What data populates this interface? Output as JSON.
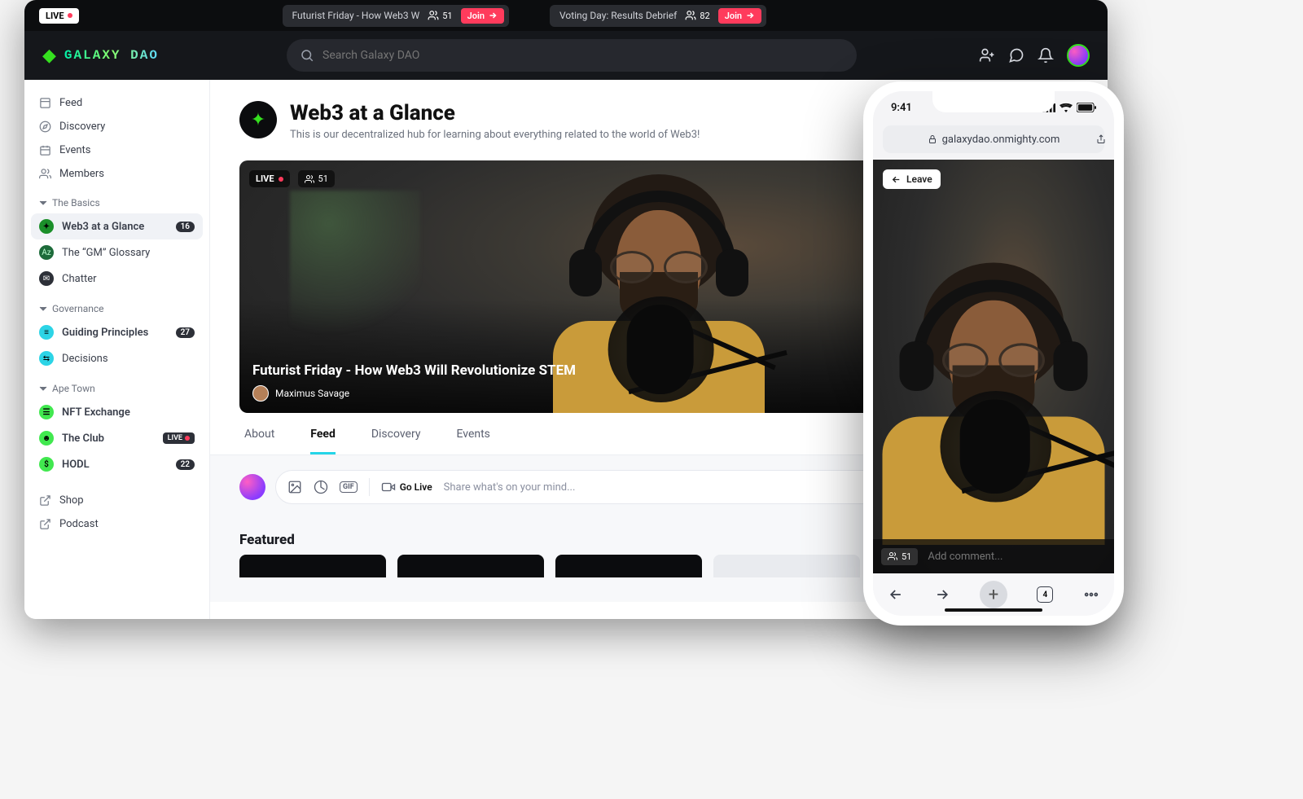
{
  "topstrip": {
    "live_label": "LIVE",
    "events": [
      {
        "title": "Futurist Friday - How Web3 W",
        "count": "51",
        "join": "Join"
      },
      {
        "title": "Voting Day: Results Debrief",
        "count": "82",
        "join": "Join"
      }
    ]
  },
  "header": {
    "brand": "GALAXY DAO",
    "search_placeholder": "Search Galaxy DAO"
  },
  "sidebar": {
    "nav": [
      {
        "label": "Feed"
      },
      {
        "label": "Discovery"
      },
      {
        "label": "Events"
      },
      {
        "label": "Members"
      }
    ],
    "sections": [
      {
        "title": "The Basics",
        "items": [
          {
            "label": "Web3 at a Glance",
            "badge": "16",
            "color": "#1b8f2a",
            "active": true
          },
          {
            "label": "The “GM” Glossary",
            "color": "#1d6b3a"
          },
          {
            "label": "Chatter",
            "color": "#2d3038"
          }
        ]
      },
      {
        "title": "Governance",
        "items": [
          {
            "label": "Guiding Principles",
            "badge": "27",
            "color": "#2cd4e6"
          },
          {
            "label": "Decisions",
            "color": "#2cd4e6"
          }
        ]
      },
      {
        "title": "Ape Town",
        "items": [
          {
            "label": "NFT Exchange",
            "color": "#41e84f"
          },
          {
            "label": "The Club",
            "live": "LIVE",
            "color": "#41e84f"
          },
          {
            "label": "HODL",
            "badge": "22",
            "color": "#41e84f"
          }
        ]
      }
    ],
    "links": [
      {
        "label": "Shop"
      },
      {
        "label": "Podcast"
      }
    ]
  },
  "page": {
    "title": "Web3 at a Glance",
    "description": "This is our decentralized hub for learning about everything related to the world of Web3!"
  },
  "hero": {
    "live": "LIVE",
    "viewers": "51",
    "title": "Futurist Friday - How Web3 Will Revolutionize STEM",
    "host": "Maximus Savage",
    "space": "Web3 at a Glance"
  },
  "tabs": [
    "About",
    "Feed",
    "Discovery",
    "Events"
  ],
  "active_tab": "Feed",
  "composer": {
    "golive": "Go Live",
    "placeholder": "Share what's on your mind..."
  },
  "featured_label": "Featured",
  "phone": {
    "time": "9:41",
    "url": "galaxydao.onmighty.com",
    "leave": "Leave",
    "viewers": "51",
    "comment_placeholder": "Add comment...",
    "tab_count": "4"
  }
}
